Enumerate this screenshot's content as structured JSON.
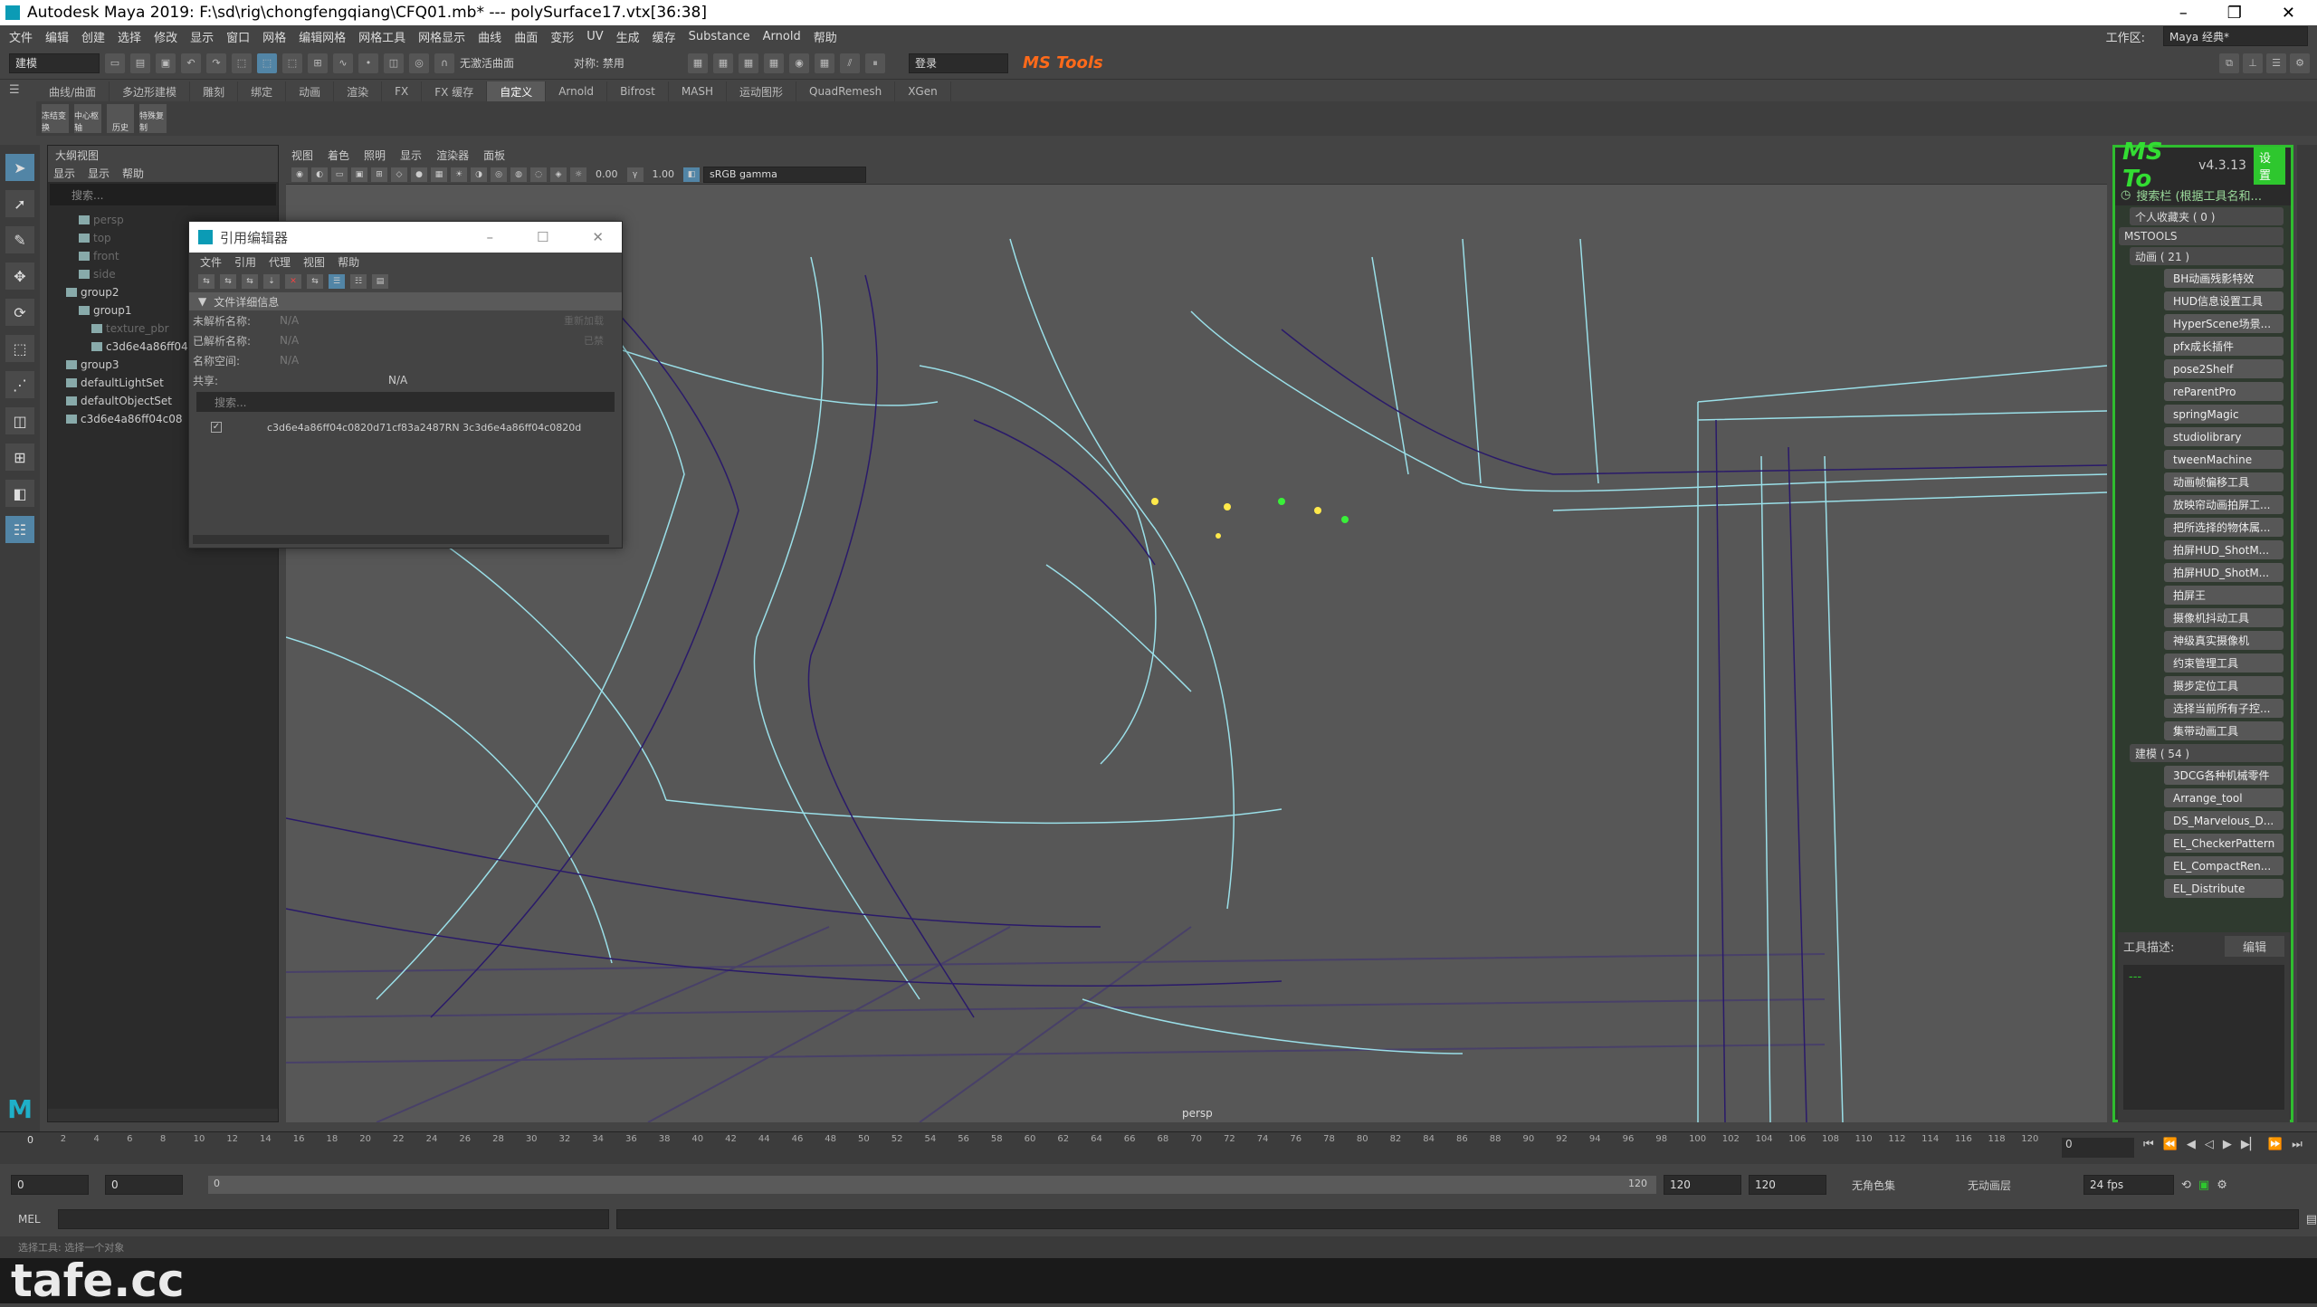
{
  "window": {
    "title": "Autodesk Maya 2019: F:\\sd\\rig\\chongfengqiang\\CFQ01.mb* --- polySurface17.vtx[36:38]",
    "min": "–",
    "max": "❐",
    "close": "✕"
  },
  "menubar": [
    "文件",
    "编辑",
    "创建",
    "选择",
    "修改",
    "显示",
    "窗口",
    "网格",
    "编辑网格",
    "网格工具",
    "网格显示",
    "曲线",
    "曲面",
    "变形",
    "UV",
    "生成",
    "缓存",
    "Substance",
    "Arnold",
    "帮助"
  ],
  "workspace": {
    "label": "工作区:",
    "value": "Maya 经典*"
  },
  "statusline": {
    "mode": "建模",
    "live": "无激活曲面",
    "symmetry": "对称: 禁用",
    "login": "登录",
    "mstools": "MS Tools"
  },
  "shelftabs": [
    "曲线/曲面",
    "多边形建模",
    "雕刻",
    "绑定",
    "动画",
    "渲染",
    "FX",
    "FX 缓存",
    "自定义",
    "Arnold",
    "Bifrost",
    "MASH",
    "运动图形",
    "QuadRemesh",
    "XGen"
  ],
  "shelf_active": "自定义",
  "shelf": [
    {
      "label": "冻结变换"
    },
    {
      "label": "中心枢轴"
    },
    {
      "label": "历史"
    },
    {
      "label": "特殊复制"
    }
  ],
  "outliner": {
    "title": "大纲视图",
    "menu": [
      "显示",
      "显示",
      "帮助"
    ],
    "search": "搜索...",
    "items": [
      {
        "label": "persp",
        "dim": true,
        "indent": 1
      },
      {
        "label": "top",
        "dim": true,
        "indent": 1
      },
      {
        "label": "front",
        "dim": true,
        "indent": 1
      },
      {
        "label": "side",
        "dim": true,
        "indent": 1
      },
      {
        "label": "group2",
        "dim": false,
        "indent": 0
      },
      {
        "label": "group1",
        "dim": false,
        "indent": 1
      },
      {
        "label": "texture_pbr",
        "dim": true,
        "indent": 2
      },
      {
        "label": "c3d6e4a86ff04",
        "dim": false,
        "indent": 2
      },
      {
        "label": "group3",
        "dim": false,
        "indent": 0
      },
      {
        "label": "defaultLightSet",
        "dim": false,
        "indent": 0
      },
      {
        "label": "defaultObjectSet",
        "dim": false,
        "indent": 0
      },
      {
        "label": "c3d6e4a86ff04c08",
        "dim": false,
        "indent": 0
      }
    ]
  },
  "viewport": {
    "menu": [
      "视图",
      "着色",
      "照明",
      "显示",
      "渲染器",
      "面板"
    ],
    "exposure": "0.00",
    "gamma": "1.00",
    "colorspace": "sRGB gamma",
    "camera": "persp"
  },
  "refeditor": {
    "title": "引用编辑器",
    "menu": [
      "文件",
      "引用",
      "代理",
      "视图",
      "帮助"
    ],
    "section": "文件详细信息",
    "fields": [
      {
        "label": "未解析名称:",
        "value": "N/A"
      },
      {
        "label": "已解析名称:",
        "value": "N/A"
      },
      {
        "label": "名称空间:",
        "value": "N/A"
      }
    ],
    "reload": "重新加载",
    "sharelabel": "共享:",
    "sharevalue": "N/A",
    "disabled": "已禁",
    "search": "搜索...",
    "row": "c3d6e4a86ff04c0820d71cf83a2487RN 3c3d6e4a86ff04c0820d"
  },
  "mstools": {
    "logo": "MS To",
    "version": "v4.3.13",
    "settings": "设置",
    "search": "搜索栏 (根据工具名和...",
    "fav": "个人收藏夹 ( 0 )",
    "root": "MSTOOLS",
    "anim_group": "动画 ( 21 )",
    "anim_items": [
      "BH动画残影特效",
      "HUD信息设置工具",
      "HyperScene场景...",
      "pfx成长插件",
      "pose2Shelf",
      "reParentPro",
      "springMagic",
      "studiolibrary",
      "tweenMachine",
      "动画帧偏移工具",
      "放映帘动画拍屏工...",
      "把所选择的物体属...",
      "拍屏HUD_ShotM...",
      "拍屏HUD_ShotM...",
      "拍屏王",
      "摄像机抖动工具",
      "神级真实摄像机",
      "约束管理工具",
      "摄步定位工具",
      "选择当前所有子控...",
      "集带动画工具"
    ],
    "model_group": "建模 ( 54 )",
    "model_items": [
      "3DCG各种机械零件",
      "Arrange_tool",
      "DS_Marvelous_D...",
      "EL_CheckerPattern",
      "EL_CompactRen...",
      "EL_Distribute"
    ],
    "desc_label": "工具描述:",
    "edit": "编辑",
    "desc": "---"
  },
  "timeline": {
    "ticks": [
      "2",
      "4",
      "6",
      "8",
      "10",
      "12",
      "14",
      "16",
      "18",
      "20",
      "22",
      "24",
      "26",
      "28",
      "30",
      "32",
      "34",
      "36",
      "38",
      "40",
      "42",
      "44",
      "46",
      "48",
      "50",
      "52",
      "54",
      "56",
      "58",
      "60",
      "62",
      "64",
      "66",
      "68",
      "70",
      "72",
      "74",
      "76",
      "78",
      "80",
      "82",
      "84",
      "86",
      "88",
      "90",
      "92",
      "94",
      "96",
      "98",
      "100",
      "102",
      "104",
      "106",
      "108",
      "110",
      "112",
      "114",
      "116",
      "118",
      "120"
    ],
    "current": "0",
    "start_mark": "0"
  },
  "range": {
    "start": "0",
    "start2": "0",
    "bar_start": "0",
    "bar_end": "120",
    "end": "120",
    "end2": "120",
    "charset": "无角色集",
    "animlayer": "无动画层",
    "fps": "24 fps"
  },
  "cmd": {
    "lang": "MEL"
  },
  "help": "选择工具: 选择一个对象",
  "watermark": "tafe.cc"
}
